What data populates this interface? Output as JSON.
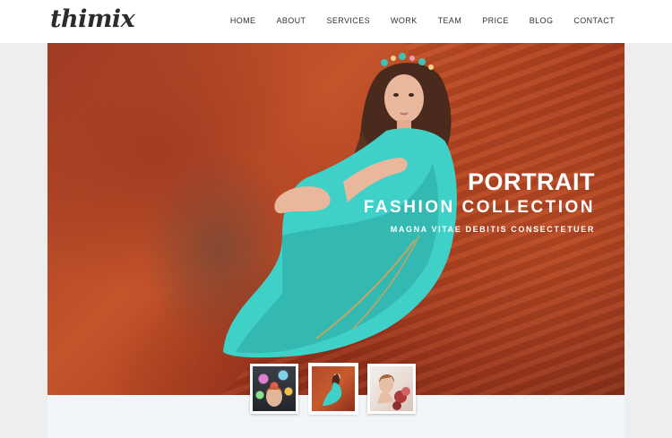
{
  "brand": {
    "logo": "thimix"
  },
  "nav": {
    "items": [
      "HOME",
      "ABOUT",
      "SERVICES",
      "WORK",
      "TEAM",
      "PRICE",
      "BLOG",
      "CONTACT"
    ]
  },
  "hero": {
    "title": "PORTRAIT",
    "subtitle": "FASHION COLLECTION",
    "tagline": "MAGNA VITAE DEBITIS CONSECTETUER"
  },
  "slider": {
    "thumbnails": [
      "fairy-lights-portrait",
      "girl-on-red-rocks",
      "girl-with-flowers"
    ],
    "active_index": 1
  },
  "colors": {
    "header_bg": "#ffffff",
    "page_bg": "#eeeeee",
    "rock_red": "#b84b25",
    "dress_teal": "#3fd0c8"
  }
}
